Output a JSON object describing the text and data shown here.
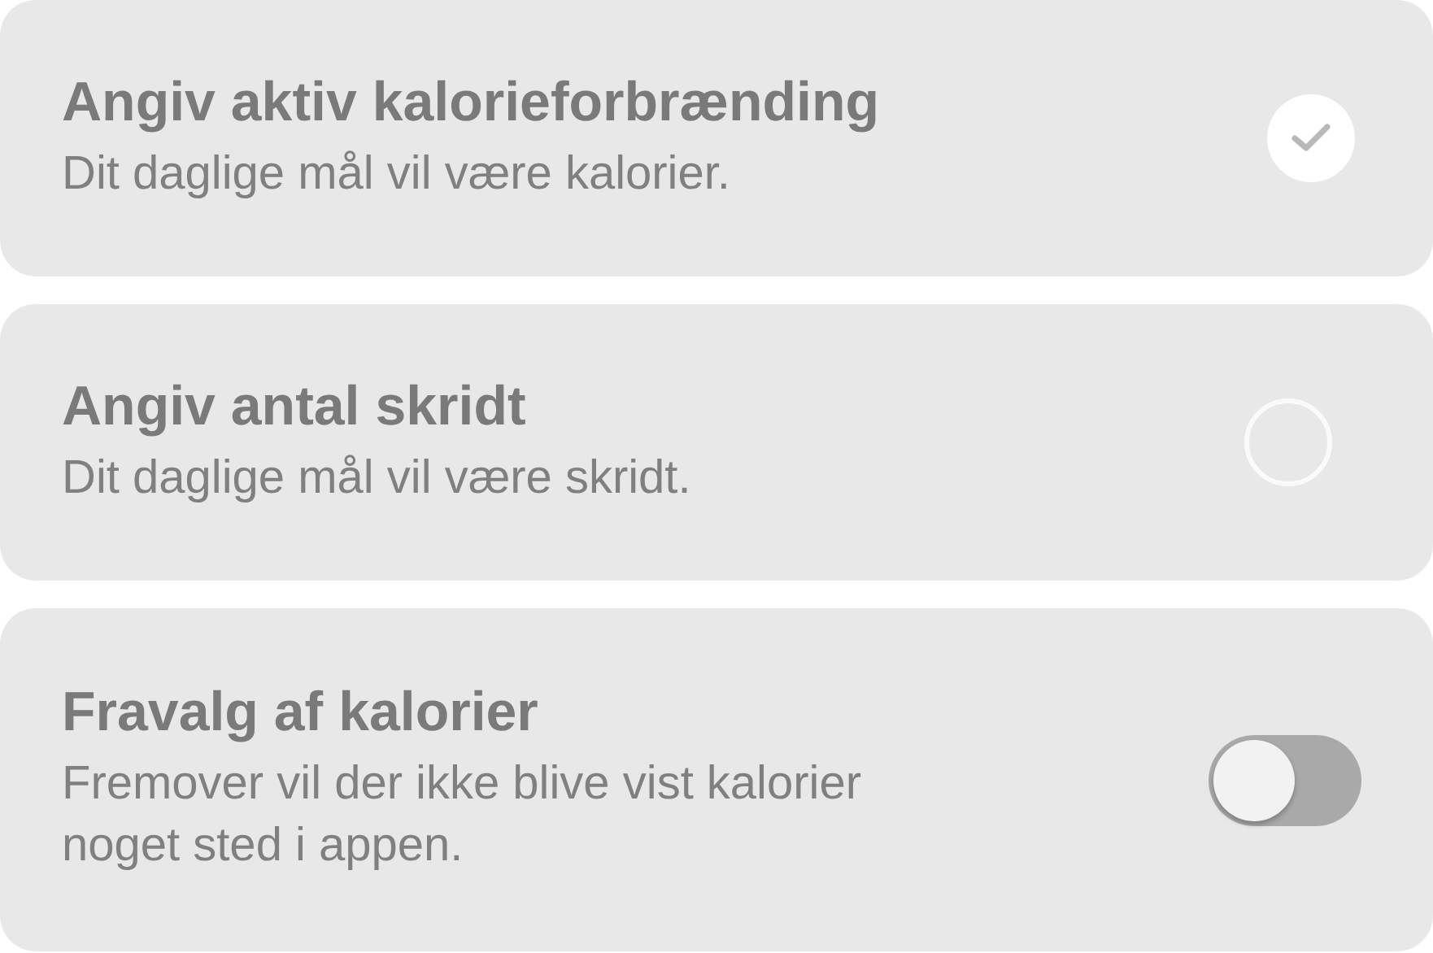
{
  "options": [
    {
      "kind": "choice",
      "title": "Angiv aktiv kalorieforbrænding",
      "description": "Dit daglige mål vil være kalorier.",
      "selected": true
    },
    {
      "kind": "choice",
      "title": "Angiv antal skridt",
      "description": "Dit daglige mål vil være skridt.",
      "selected": false
    },
    {
      "kind": "toggle",
      "title": "Fravalg af kalorier",
      "description": "Fremover vil der ikke blive vist kalorier noget sted i appen.",
      "on": false
    }
  ]
}
